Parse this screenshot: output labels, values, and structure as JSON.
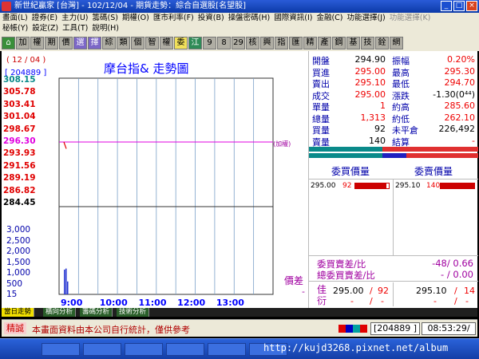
{
  "window": {
    "title": "新世紀贏家 [台灣] - 102/12/04 - 期貨走勢：綜合自選股[名望股]"
  },
  "menu": {
    "row1": [
      "畫面(L)",
      "證券(E)",
      "主力(U)",
      "籌碼(S)",
      "期權(O)",
      "匯市利率(F)",
      "投資(B)",
      "操盤密碼(H)",
      "國際資訊(I)",
      "金融(C)",
      "功能選擇(J)",
      "功能選擇(K)"
    ],
    "row1_dim": [
      false,
      false,
      false,
      false,
      false,
      false,
      false,
      false,
      false,
      false,
      false,
      true
    ],
    "row2": [
      "秘帳(Y)",
      "設定(Z)",
      "工具(T)",
      "說明(H)"
    ]
  },
  "toolbar": {
    "buttons": [
      "⌂",
      "加",
      "權",
      "期",
      "價",
      "選",
      "擇",
      "綜",
      "類",
      "個",
      "智",
      "權",
      "委",
      "江",
      "9",
      "8",
      "29",
      "核",
      "興",
      "指",
      "匯",
      "精",
      "產",
      "鋼",
      "基",
      "技",
      "銓",
      "網"
    ]
  },
  "chart": {
    "date": "( 12 / 04 )",
    "code": "[ 204889 ]",
    "title": "摩台指&  走勢圖",
    "note": "(加權)",
    "price_labels": [
      "308.15",
      "305.78",
      "303.41",
      "301.04",
      "298.67",
      "296.30",
      "293.93",
      "291.56",
      "289.19",
      "286.82",
      "284.45"
    ],
    "price_colors": [
      "#0a8a8a",
      "#e00000",
      "#e00000",
      "#e00000",
      "#e00000",
      "#e000e0",
      "#e00000",
      "#e00000",
      "#e00000",
      "#e00000",
      "#000000"
    ],
    "volume_labels": [
      "3,000",
      "2,500",
      "2,000",
      "1,500",
      "1,000",
      "500",
      "15"
    ],
    "time_labels": [
      "9:00",
      "10:00",
      "11:00",
      "12:00",
      "13:00"
    ],
    "price_diff_label": "價差",
    "price_diff_value": "-"
  },
  "chart_data": {
    "type": "line",
    "title": "摩台指&  走勢圖",
    "x_ticks": [
      "9:00",
      "10:00",
      "11:00",
      "12:00",
      "13:00"
    ],
    "y_ticks": [
      308.15,
      305.78,
      303.41,
      301.04,
      298.67,
      296.3,
      293.93,
      291.56,
      289.19,
      286.82,
      284.45
    ],
    "ylim": [
      284.45,
      308.15
    ],
    "reference_price": 296.3,
    "series": [
      {
        "values": [
          296.3,
          295.0
        ]
      }
    ],
    "volume": {
      "ticks": [
        3000,
        2500,
        2000,
        1500,
        1000,
        500,
        15
      ],
      "values": [
        1150,
        1200,
        600
      ],
      "ylim": [
        0,
        3000
      ]
    },
    "grid": true
  },
  "quote": {
    "rows": [
      {
        "l1": "開盤",
        "v1": "294.90",
        "l2": "振幅",
        "v2": "0.20%"
      },
      {
        "l1": "買進",
        "v1": "295.00",
        "l2": "最高",
        "v2": "295.30"
      },
      {
        "l1": "賣出",
        "v1": "295.10",
        "l2": "最低",
        "v2": "294.70"
      },
      {
        "l1": "成交",
        "v1": "295.00",
        "l2": "漲跌",
        "v2": "-1.30(0⁴⁴)"
      },
      {
        "l1": "單量",
        "v1": "1",
        "l2": "約高",
        "v2": "285.60"
      },
      {
        "l1": "總量",
        "v1": "1,313",
        "l2": "約低",
        "v2": "262.10"
      },
      {
        "l1": "買量",
        "v1": "92",
        "l2": "未平倉",
        "v2": "226,492"
      },
      {
        "l1": "賣量",
        "v1": "140",
        "l2": "結算",
        "v2": "-"
      }
    ],
    "bid_header": "委買價量",
    "ask_header": "委賣價量",
    "bid_price": "295.00",
    "bid_qty": "92",
    "ask_price": "295.10",
    "ask_qty": "140",
    "diff_ratio_label": "委買賣差/比",
    "diff_ratio_value": "-48/ 0.66",
    "total_ratio_label": "總委買賣差/比",
    "total_ratio_value": "- / 0.00",
    "best_label": "佳衍",
    "best_bid": "295.00",
    "best_bid_qty": "92",
    "best_ask": "295.10",
    "best_ask_qty": "14",
    "best_row2": [
      "-",
      "/",
      "-",
      "-",
      "/",
      "-"
    ]
  },
  "tabs": [
    "當日走勢",
    "橫向分析",
    "籌碼分析",
    "技術分析"
  ],
  "status": {
    "tag": "精誠",
    "message": "本畫面資料由本公司自行統計，僅供參考",
    "code": "[204889 ]",
    "time": "08:53:29/"
  },
  "taskbar": {
    "items": [
      "",
      "",
      "",
      "",
      "",
      ""
    ],
    "url": "http://kujd3268.pixnet.net/album"
  }
}
